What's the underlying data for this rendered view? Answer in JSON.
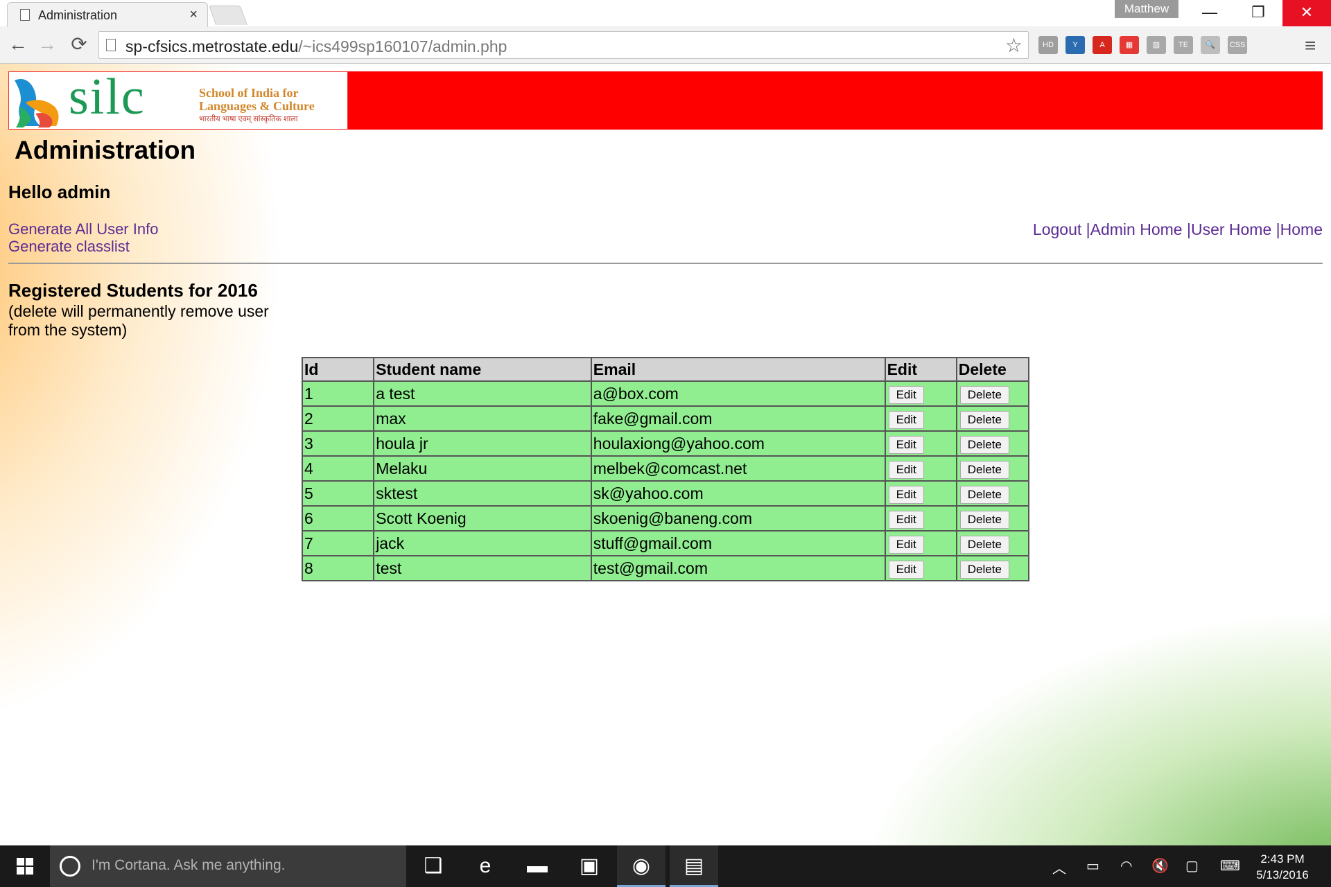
{
  "browser": {
    "tab_title": "Administration",
    "tab_close": "×",
    "profile_name": "Matthew",
    "url_host": "sp-cfsics.metrostate.edu",
    "url_path": "/~ics499sp160107/admin.php",
    "window_min": "—",
    "window_max": "❐",
    "window_close": "✕",
    "back": "←",
    "forward": "→",
    "reload": "⟳",
    "star": "☆",
    "menu": "≡",
    "extensions": [
      {
        "icon": "hd-extension-icon",
        "label": "HD",
        "color": "#9e9e9e"
      },
      {
        "icon": "y-extension-icon",
        "label": "Y",
        "color": "#2b6cb0"
      },
      {
        "icon": "pdf-extension-icon",
        "label": "A",
        "color": "#d7261e"
      },
      {
        "icon": "grid-extension-icon",
        "label": "▦",
        "color": "#e53935"
      },
      {
        "icon": "chart-extension-icon",
        "label": "▨",
        "color": "#a8a8a8"
      },
      {
        "icon": "tineye-extension-icon",
        "label": "TE",
        "color": "#a8a8a8"
      },
      {
        "icon": "magnifier-extension-icon",
        "label": "🔍",
        "color": "#bdbdbd"
      },
      {
        "icon": "css-extension-icon",
        "label": "CSS",
        "color": "#a8a8a8"
      }
    ]
  },
  "logo": {
    "word": "silc",
    "line1": "School of India for",
    "line2": "Languages & Culture",
    "line3": "भारतीय भाषा एवम् सांस्कृतिक शाला"
  },
  "page": {
    "title": "Administration",
    "greeting": "Hello admin",
    "left_links": [
      "Generate All User Info",
      "Generate classlist"
    ],
    "right_links": [
      "Logout",
      "Admin Home",
      "User Home",
      "Home"
    ],
    "link_separator": " |",
    "section_title": "Registered Students for 2016",
    "section_note": "(delete will permanently remove user from the system)"
  },
  "table": {
    "headers": [
      "Id",
      "Student name",
      "Email",
      "Edit",
      "Delete"
    ],
    "edit_label": "Edit",
    "delete_label": "Delete",
    "rows": [
      {
        "id": "1",
        "name": "a test",
        "email": "a@box.com"
      },
      {
        "id": "2",
        "name": "max",
        "email": "fake@gmail.com"
      },
      {
        "id": "3",
        "name": "houla jr",
        "email": "houlaxiong@yahoo.com"
      },
      {
        "id": "4",
        "name": "Melaku",
        "email": "melbek@comcast.net"
      },
      {
        "id": "5",
        "name": "sktest",
        "email": "sk@yahoo.com"
      },
      {
        "id": "6",
        "name": "Scott Koenig",
        "email": "skoenig@baneng.com"
      },
      {
        "id": "7",
        "name": "jack",
        "email": "stuff@gmail.com"
      },
      {
        "id": "8",
        "name": "test",
        "email": "test@gmail.com"
      }
    ]
  },
  "taskbar": {
    "cortana_placeholder": "I'm Cortana. Ask me anything.",
    "time": "2:43 PM",
    "date": "5/13/2016",
    "apps": [
      {
        "icon": "task-view-icon",
        "glyph": "❑",
        "running": false
      },
      {
        "icon": "edge-icon",
        "glyph": "e",
        "running": false
      },
      {
        "icon": "file-explorer-icon",
        "glyph": "▬",
        "running": false
      },
      {
        "icon": "store-icon",
        "glyph": "▣",
        "running": false
      },
      {
        "icon": "chrome-icon",
        "glyph": "◉",
        "running": true
      },
      {
        "icon": "notepad-icon",
        "glyph": "▤",
        "running": true
      }
    ],
    "tray": [
      {
        "icon": "chevron-up-icon",
        "glyph": "︿"
      },
      {
        "icon": "battery-icon",
        "glyph": "▭"
      },
      {
        "icon": "wifi-icon",
        "glyph": "◠"
      },
      {
        "icon": "volume-muted-icon",
        "glyph": "🔇"
      },
      {
        "icon": "action-center-icon",
        "glyph": "▢"
      },
      {
        "icon": "keyboard-icon",
        "glyph": "⌨"
      }
    ]
  },
  "colors": {
    "banner": "#ff0000",
    "link": "#5b2c93",
    "table_header": "#d3d3d3",
    "table_row": "#90ee90",
    "close_button": "#e81123"
  }
}
